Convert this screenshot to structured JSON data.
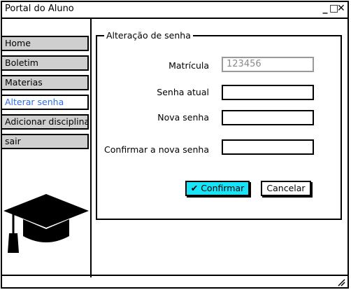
{
  "window": {
    "title": "Portal do Aluno",
    "controls": {
      "minimize": "_",
      "maximize": "□",
      "close": "✕"
    }
  },
  "sidebar": {
    "items": [
      {
        "label": "Home",
        "active": false
      },
      {
        "label": "Boletim",
        "active": false
      },
      {
        "label": "Materias",
        "active": false
      },
      {
        "label": "Alterar senha",
        "active": true
      },
      {
        "label": "Adicionar disciplinas",
        "active": false
      },
      {
        "label": "sair",
        "active": false
      }
    ],
    "logo_icon": "graduation-cap-icon"
  },
  "form": {
    "legend": "Alteração de senha",
    "matricula_label": "Matrícula",
    "matricula_value": "123456",
    "senha_atual_label": "Senha atual",
    "nova_senha_label": "Nova senha",
    "confirmar_label": "Confirmar a nova senha",
    "confirm_button": "Confirmar",
    "cancel_button": "Cancelar"
  },
  "colors": {
    "accent_button": "#19e3f7",
    "active_nav_text": "#2c6cf0",
    "nav_background": "#cfcfcf"
  }
}
